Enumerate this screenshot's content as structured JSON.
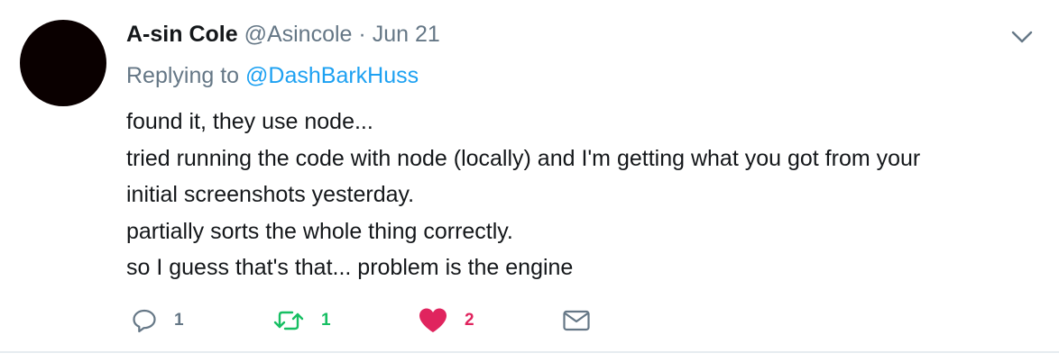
{
  "tweet": {
    "author_name": "A-sin Cole",
    "author_handle": "@Asincole",
    "separator": "·",
    "date": "Jun 21",
    "replying_prefix": "Replying to",
    "replying_to": "@DashBarkHuss",
    "text_lines": [
      "found it, they use node...",
      "tried running the code with node (locally) and I'm getting what you got from your",
      "initial screenshots yesterday.",
      "partially sorts the whole thing correctly.",
      "so I guess that's that... problem is the engine"
    ],
    "actions": {
      "reply": {
        "icon": "reply-icon",
        "count": "1",
        "color": "#657786"
      },
      "retweet": {
        "icon": "retweet-icon",
        "count": "1",
        "color": "#17bf63"
      },
      "like": {
        "icon": "heart-icon",
        "count": "2",
        "color": "#e0245e"
      },
      "message": {
        "icon": "envelope-icon",
        "color": "#657786"
      }
    },
    "more_icon": "chevron-down-icon"
  }
}
